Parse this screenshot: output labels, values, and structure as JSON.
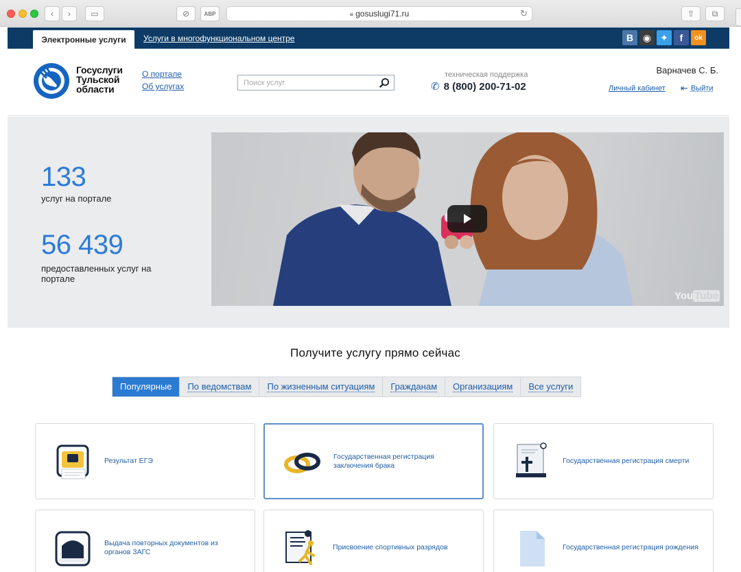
{
  "browser": {
    "url": "gosuslugi71.ru"
  },
  "topbar": {
    "active_tab": "Электронные услуги",
    "link": "Услуги в многофункциональном центре",
    "social": [
      {
        "name": "vk-icon",
        "glyph": "В",
        "color": "#4a76a8"
      },
      {
        "name": "instagram-icon",
        "glyph": "◉",
        "color": "#3d3d3d"
      },
      {
        "name": "twitter-icon",
        "glyph": "✦",
        "color": "#3aa0e8"
      },
      {
        "name": "facebook-icon",
        "glyph": "f",
        "color": "#3b5998"
      },
      {
        "name": "odnoklassniki-icon",
        "glyph": "ok",
        "color": "#f29120"
      }
    ]
  },
  "header": {
    "logo_lines": [
      "Госуслуги",
      "Тульской",
      "области"
    ],
    "links": [
      "О портале",
      "Об услугах"
    ],
    "search_placeholder": "Поиск услуг",
    "support_label": "техническая поддержка",
    "phone": "8 (800) 200-71-02",
    "user_name": "Варначев С. Б.",
    "cabinet_link": "Личный кабинет",
    "logout": "Выйти"
  },
  "hero": {
    "stats": [
      {
        "value": "133",
        "label": "услуг на портале"
      },
      {
        "value": "56 439",
        "label": "предоставленных услуг на портале"
      }
    ],
    "video_watermark": "YouTube"
  },
  "services": {
    "title": "Получите услугу прямо сейчас",
    "tabs": [
      "Популярные",
      "По ведомствам",
      "По жизненным ситуациям",
      "Гражданам",
      "Организациям",
      "Все услуги"
    ],
    "active_tab": 0,
    "cards": [
      {
        "title": "Результат ЕГЭ",
        "icon": "exam-result-icon"
      },
      {
        "title": "Государственная регистрация заключения брака",
        "icon": "wedding-rings-icon"
      },
      {
        "title": "Государственная регистрация смерти",
        "icon": "death-registration-icon"
      },
      {
        "title": "Выдача повторных документов из органов ЗАГС",
        "icon": "registry-office-icon"
      },
      {
        "title": "Присвоение спортивных разрядов",
        "icon": "sports-rank-icon"
      },
      {
        "title": "Государственная регистрация рождения",
        "icon": "document-icon"
      }
    ]
  },
  "colors": {
    "topbar": "#0d3b66",
    "accent": "#2b7bd3",
    "link": "#1e5da8",
    "stat": "#2d7ad8"
  }
}
